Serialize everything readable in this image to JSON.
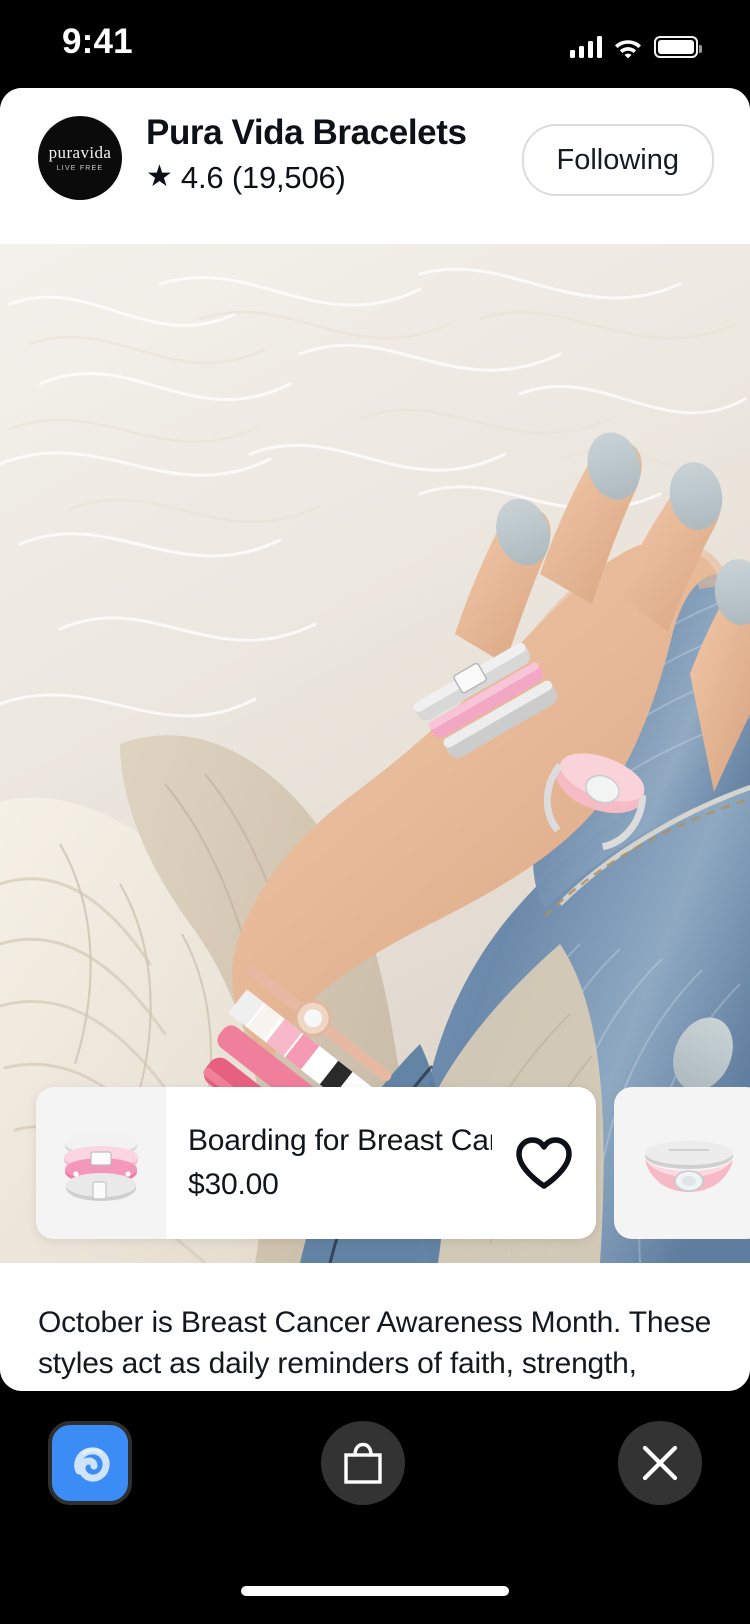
{
  "status_bar": {
    "time": "9:41",
    "signal_icon": "cellular-signal-icon",
    "wifi_icon": "wifi-icon",
    "battery_icon": "battery-full-icon"
  },
  "brand_header": {
    "avatar": {
      "word": "puravida",
      "tagline": "LIVE  FREE",
      "icon": "brand-avatar"
    },
    "name": "Pura Vida Bracelets",
    "star_icon": "★",
    "rating": "4.6 (19,506)",
    "follow_button": "Following"
  },
  "media": {
    "description": "Hand with stacked pink enamel rings and beaded bracelets resting on denim and white fur"
  },
  "products": [
    {
      "title": "Boarding for Breast Canc...",
      "price": "$30.00",
      "favorite_icon": "heart-outline-icon",
      "thumb": "stacked-pink-enamel-rings"
    },
    {
      "thumb": "pink-signet-ring"
    }
  ],
  "caption": {
    "text": "October is Breast Cancer Awareness Month. These styles act as daily reminders of faith, strength, and..."
  },
  "toolbar": {
    "app_icon": "app-switch-icon",
    "bag_icon": "shopping-bag-icon",
    "close_icon": "close-x-icon"
  },
  "colors": {
    "accent_blue": "#3b8cf5",
    "toolbar_bg": "#000000",
    "circle_btn": "#333333",
    "text_primary": "#11151c",
    "border_light": "#dcdcdc"
  }
}
